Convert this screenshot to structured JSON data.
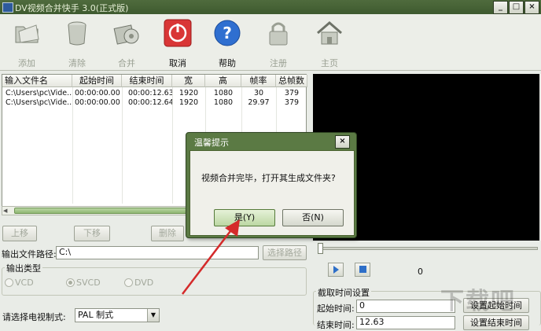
{
  "window": {
    "title": "DV视频合并快手 3.0(正式版)",
    "minimize": "_",
    "maximize": "□",
    "close": "×"
  },
  "toolbar": {
    "add": "添加",
    "clear": "清除",
    "merge": "合并",
    "cancel": "取消",
    "help": "帮助",
    "register": "注册",
    "home": "主页"
  },
  "list": {
    "headers": [
      "输入文件名",
      "起始时间",
      "结束时间",
      "宽",
      "高",
      "帧率",
      "总帧数"
    ],
    "rows": [
      [
        "C:\\Users\\pc\\Vide...",
        "00:00:00.00",
        "00:00:12.63",
        "1920",
        "1080",
        "30",
        "379"
      ],
      [
        "C:\\Users\\pc\\Vide...",
        "00:00:00.00",
        "00:00:12.64",
        "1920",
        "1080",
        "29.97",
        "379"
      ]
    ]
  },
  "actions": {
    "up": "上移",
    "down": "下移",
    "delete": "删除"
  },
  "output": {
    "path_label": "输出文件路径:",
    "path_value": "C:\\",
    "choose_path": "选择路径",
    "type_label": "输出类型",
    "types": [
      "VCD",
      "SVCD",
      "DVD"
    ],
    "tv_label": "请选择电视制式:",
    "tv_value": "PAL 制式"
  },
  "player": {
    "counter": "0"
  },
  "time_settings": {
    "label": "截取时间设置",
    "start_label": "起始时间:",
    "start_value": "0",
    "end_label": "结束时间:",
    "end_value": "12.63",
    "set_start": "设置起始时间",
    "set_end": "设置结束时间"
  },
  "dialog": {
    "title": "温馨提示",
    "close": "×",
    "message": "视频合并完毕，打开其生成文件夹?",
    "yes": "是(Y)",
    "no": "否(N)"
  },
  "watermark": "下载吧",
  "colors": {
    "accent": "#5b7a44",
    "arrow": "#d42a2a",
    "play": "#2e6fc8"
  },
  "icons": [
    "folder-icon",
    "trash-can-icon",
    "film-reel-icon",
    "power-stop-icon",
    "help-icon",
    "padlock-icon",
    "house-icon",
    "play-icon",
    "stop-icon",
    "dropdown-arrow-icon"
  ]
}
